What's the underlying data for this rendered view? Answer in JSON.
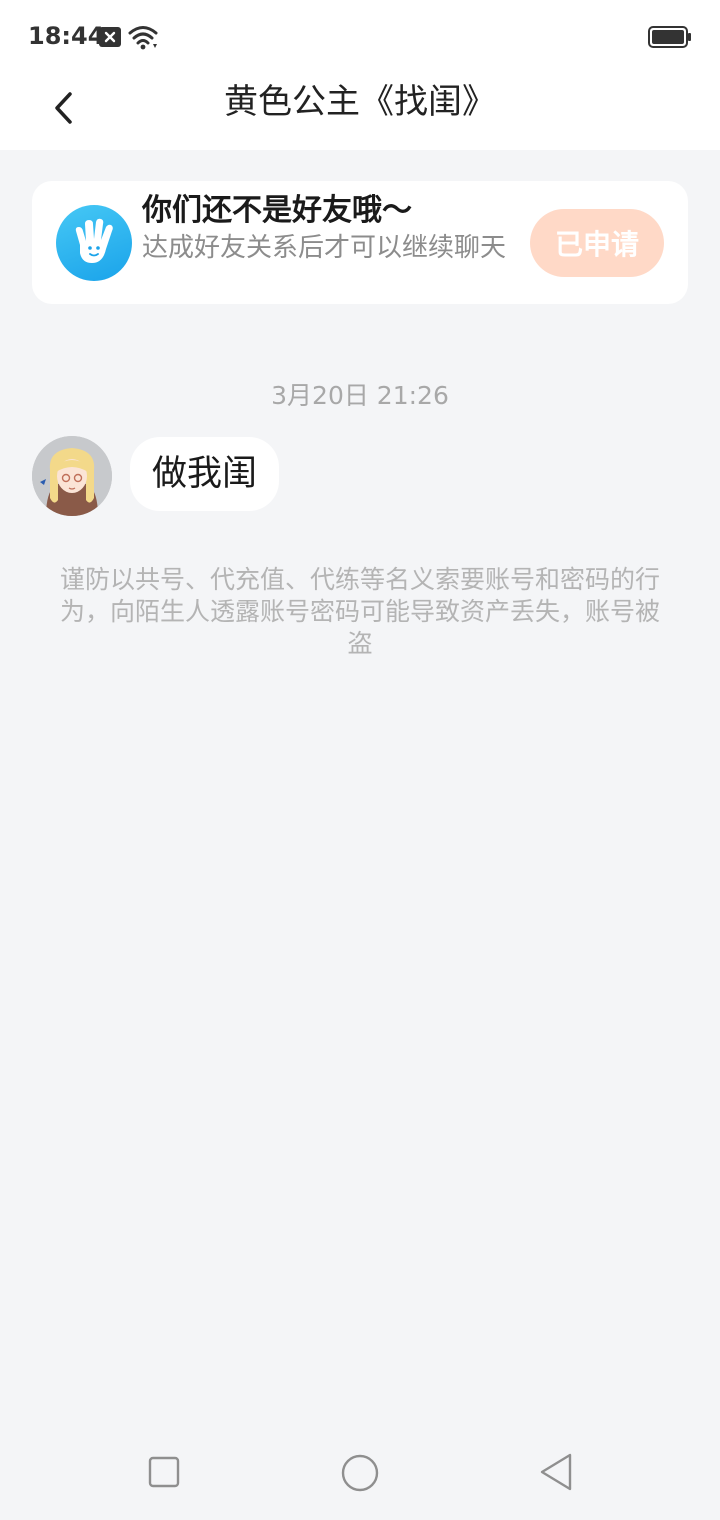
{
  "status_bar": {
    "time": "18:44",
    "icons": [
      "notification-x-icon",
      "wifi-icon",
      "battery-icon"
    ]
  },
  "header": {
    "back_icon": "chevron-left-icon",
    "title": "黄色公主《找闺》"
  },
  "friend_notice": {
    "icon": "waving-hand-icon",
    "title": "你们还不是好友哦～",
    "subtitle": "达成好友关系后才可以继续聊天",
    "button_label": "已申请"
  },
  "chat": {
    "timestamp": "3月20日 21:26",
    "messages": [
      {
        "sender": "other",
        "avatar": "anime-girl-avatar",
        "text": "做我闺"
      }
    ],
    "safety_warning": "谨防以共号、代充值、代练等名义索要账号和密码的行为，向陌生人透露账号密码可能导致资产丢失，账号被盗"
  },
  "system_nav": {
    "icons": [
      "recent-apps-icon",
      "home-icon",
      "back-icon"
    ]
  },
  "colors": {
    "page_bg": "#f4f5f7",
    "applied_button_bg": "#ffd9c7",
    "hand_icon_bg": "#1aa3ea",
    "muted_text": "#a8a8a8"
  }
}
